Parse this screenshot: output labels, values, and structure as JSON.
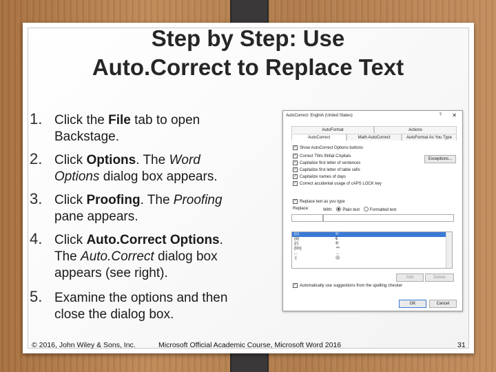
{
  "title": {
    "line1": "Step by Step: Use",
    "line2": "Auto.Correct  to Replace Text"
  },
  "steps": [
    {
      "num": "1.",
      "a": "Click the ",
      "b": "File",
      "c": " tab to open",
      "d": "Backstage."
    },
    {
      "num": "2.",
      "a": "Click ",
      "b": "Options",
      "c": ". The ",
      "i": "Word",
      "d_i": "Options",
      "d": " dialog box appears."
    },
    {
      "num": "3.",
      "a": "Click ",
      "b": "Proofing",
      "c": ". The ",
      "i": "Proofing",
      "d": "pane appears."
    },
    {
      "num": "4.",
      "a": "Click ",
      "b": "Auto.Correct Options",
      "c": ".",
      "l2a": "The ",
      "l2i": "Auto.Correct",
      "l2b": " dialog box",
      "l3": "appears (see right)."
    },
    {
      "num": "5.",
      "a": "Examine the options and then",
      "d": "close the dialog box."
    }
  ],
  "footer": {
    "left": "© 2016, John Wiley & Sons, Inc.",
    "center": "Microsoft Official Academic Course, Microsoft Word 2016",
    "page": "31"
  },
  "dialog": {
    "title": "AutoCorrect: English (United States)",
    "help": "?",
    "close": "✕",
    "tabs_top": [
      "AutoFormat",
      "Actions"
    ],
    "tabs_bottom": [
      "AutoCorrect",
      "Math AutoCorrect",
      "AutoFormat As You Type"
    ],
    "checks": [
      "Show AutoCorrect Options buttons",
      "Correct TWo INitial CApitals",
      "Capitalize first letter of sentences",
      "Capitalize first letter of table cells",
      "Capitalize names of days",
      "Correct accidental usage of cAPS LOCK key"
    ],
    "exceptions": "Exceptions...",
    "replace_check": "Replace text as you type",
    "replace_label": "Replace:",
    "with_label": "With:",
    "plain": "Plain text",
    "formatted": "Formatted text",
    "list": [
      {
        "k": "(c)",
        "v": "©"
      },
      {
        "k": "(e)",
        "v": "€"
      },
      {
        "k": "(r)",
        "v": "®"
      },
      {
        "k": "(tm)",
        "v": "™"
      },
      {
        "k": "...",
        "v": "…"
      },
      {
        "k": ":(",
        "v": "☹"
      }
    ],
    "add": "Add",
    "delete": "Delete",
    "auto_suggest": "Automatically use suggestions from the spelling checker",
    "ok": "OK",
    "cancel": "Cancel"
  }
}
